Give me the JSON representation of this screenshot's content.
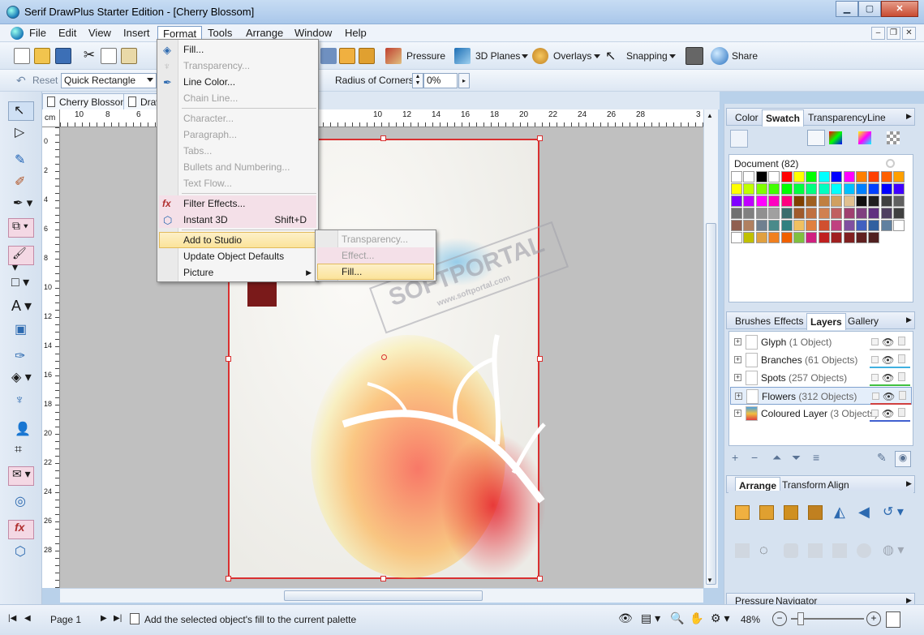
{
  "window": {
    "title": "Serif DrawPlus Starter Edition - [Cherry Blossom]"
  },
  "menubar": {
    "items": [
      "File",
      "Edit",
      "View",
      "Insert",
      "Format",
      "Tools",
      "Arrange",
      "Window",
      "Help"
    ],
    "active": "Format"
  },
  "toolbar": {
    "pressure": "Pressure",
    "planes": "3D Planes",
    "overlays": "Overlays",
    "snapping": "Snapping",
    "share": "Share"
  },
  "context_bar": {
    "reset": "Reset",
    "shape_combo": "Quick Rectangle",
    "radius_label": "Radius of Corners:",
    "radius_value": "0%"
  },
  "doc_tabs": [
    "Cherry Blossom",
    "Draw"
  ],
  "ruler": {
    "unit": "cm",
    "h_ticks": [
      "10",
      "8",
      "6",
      "10",
      "12",
      "14",
      "16",
      "18",
      "20",
      "22",
      "24",
      "26",
      "28",
      "3"
    ],
    "v_ticks": [
      "0",
      "2",
      "4",
      "6",
      "8",
      "10",
      "12",
      "14",
      "16",
      "18",
      "20",
      "22",
      "24",
      "26",
      "28"
    ]
  },
  "format_menu": {
    "items": [
      {
        "label": "Fill...",
        "disabled": false
      },
      {
        "label": "Transparency...",
        "disabled": true
      },
      {
        "label": "Line Color...",
        "disabled": false
      },
      {
        "label": "Chain Line...",
        "disabled": true
      },
      {
        "label": "Character...",
        "disabled": true
      },
      {
        "label": "Paragraph...",
        "disabled": true
      },
      {
        "label": "Tabs...",
        "disabled": true
      },
      {
        "label": "Bullets and Numbering...",
        "disabled": true
      },
      {
        "label": "Text Flow...",
        "disabled": true
      },
      {
        "label": "Filter Effects...",
        "disabled": false
      },
      {
        "label": "Instant 3D",
        "shortcut": "Shift+D",
        "disabled": false
      },
      {
        "label": "Add to Studio",
        "disabled": false,
        "highlighted": true
      },
      {
        "label": "Update Object Defaults",
        "disabled": false
      },
      {
        "label": "Picture",
        "disabled": false,
        "submenu": true
      }
    ]
  },
  "submenu": {
    "items": [
      {
        "label": "Transparency...",
        "disabled": true
      },
      {
        "label": "Effect...",
        "disabled": true
      },
      {
        "label": "Fill...",
        "disabled": false,
        "highlighted": true
      }
    ]
  },
  "watermark": {
    "text": "SOFTPORTAL",
    "url": "www.softportal.com"
  },
  "color_panel": {
    "tabs": [
      "Color",
      "Swatch",
      "Transparency",
      "Line"
    ],
    "active": "Swatch",
    "palette_name": "Document (82)",
    "swatches": [
      "#ffffff",
      "#ffffff",
      "#000000",
      "#ffffff",
      "#ff0000",
      "#ffff00",
      "#00ff00",
      "#00ffff",
      "#0000ff",
      "#ff00ff",
      "#ff8000",
      "#ff4000",
      "#ff6000",
      "#ffa000",
      "#ffff00",
      "#c0ff00",
      "#80ff00",
      "#40ff00",
      "#00ff00",
      "#00ff40",
      "#00ff80",
      "#00ffc0",
      "#00ffff",
      "#00c0ff",
      "#0080ff",
      "#0040ff",
      "#0000ff",
      "#4000ff",
      "#8000ff",
      "#c000ff",
      "#ff00ff",
      "#ff00c0",
      "#ff0080",
      "#804000",
      "#a06020",
      "#c08040",
      "#d0a060",
      "#e0c090",
      "#101010",
      "#202020",
      "#404040",
      "#606060",
      "#707070",
      "#808080",
      "#909090",
      "#a0a0a0",
      "#3b6e6e",
      "#a05a2c",
      "#c07040",
      "#d08050",
      "#c06060",
      "#a04070",
      "#804080",
      "#603080",
      "#504060",
      "#404040",
      "#906050",
      "#b08060",
      "#708090",
      "#4a8a8a",
      "#308080",
      "#f0c060",
      "#e08040",
      "#d05030",
      "#c04080",
      "#8050a0",
      "#4060c0",
      "#3060a0",
      "#6080a0",
      "#ffffff",
      "#ffffff",
      "#c0c000",
      "#e0a040",
      "#f08020",
      "#f06000",
      "#80c040",
      "#d02080",
      "#c02020",
      "#a02020",
      "#802020",
      "#602020",
      "#502020"
    ]
  },
  "layers_panel": {
    "tabs": [
      "Brushes",
      "Effects",
      "Layers",
      "Gallery"
    ],
    "active": "Layers",
    "layers": [
      {
        "name": "Glyph",
        "count": "(1 Object)",
        "underline": "#c0c0c0"
      },
      {
        "name": "Branches",
        "count": "(61 Objects)",
        "underline": "#40b0e0"
      },
      {
        "name": "Spots",
        "count": "(257 Objects)",
        "underline": "#40c040"
      },
      {
        "name": "Flowers",
        "count": "(312 Objects)",
        "underline": "#d04040",
        "selected": true
      },
      {
        "name": "Coloured Layer",
        "count": "(3 Objects)",
        "underline": "#4060d0"
      }
    ]
  },
  "arrange_panel": {
    "tabs": [
      "Arrange",
      "Transform",
      "Align"
    ],
    "active": "Arrange"
  },
  "navigator_panel": {
    "tabs": [
      "Pressure",
      "Navigator"
    ]
  },
  "status": {
    "page": "Page 1",
    "hint": "Add the selected object's fill to the current palette",
    "zoom": "48%"
  },
  "colors": {
    "accent": "#d93030",
    "menu_highlight": "#fbe39a",
    "chrome": "#d6e2f0"
  }
}
